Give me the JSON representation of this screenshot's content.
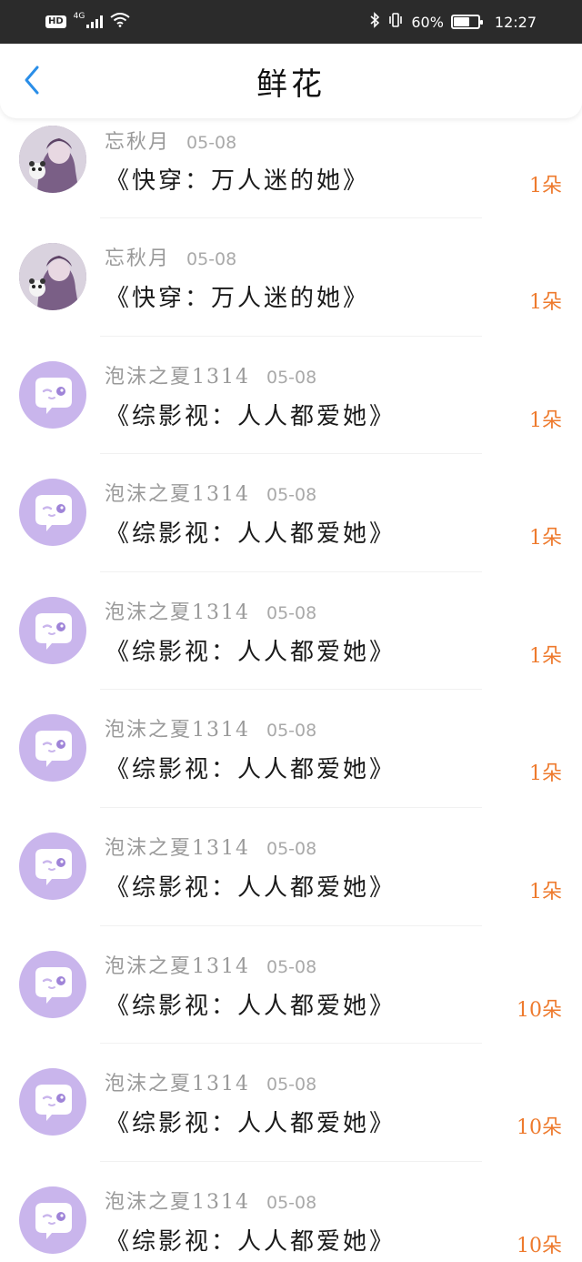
{
  "status_bar": {
    "hd": "HD",
    "network": "4G",
    "battery_percent": "60%",
    "battery_level": 0.6,
    "time": "12:27"
  },
  "header": {
    "back_icon": "chevron-left-icon",
    "title": "鲜花"
  },
  "colors": {
    "accent_blue": "#2a8ee8",
    "count_orange": "#ee7a2d",
    "avatar_purple": "#c9b5ec"
  },
  "items": [
    {
      "user": "忘秋月",
      "date": "05-08",
      "book": "《快穿：万人迷的她》",
      "count": "1朵",
      "avatar": "photo-avatar"
    },
    {
      "user": "忘秋月",
      "date": "05-08",
      "book": "《快穿：万人迷的她》",
      "count": "1朵",
      "avatar": "photo-avatar"
    },
    {
      "user": "泡沫之夏1314",
      "date": "05-08",
      "book": "《综影视：人人都爱她》",
      "count": "1朵",
      "avatar": "chat-bot-avatar"
    },
    {
      "user": "泡沫之夏1314",
      "date": "05-08",
      "book": "《综影视：人人都爱她》",
      "count": "1朵",
      "avatar": "chat-bot-avatar"
    },
    {
      "user": "泡沫之夏1314",
      "date": "05-08",
      "book": "《综影视：人人都爱她》",
      "count": "1朵",
      "avatar": "chat-bot-avatar"
    },
    {
      "user": "泡沫之夏1314",
      "date": "05-08",
      "book": "《综影视：人人都爱她》",
      "count": "1朵",
      "avatar": "chat-bot-avatar"
    },
    {
      "user": "泡沫之夏1314",
      "date": "05-08",
      "book": "《综影视：人人都爱她》",
      "count": "1朵",
      "avatar": "chat-bot-avatar"
    },
    {
      "user": "泡沫之夏1314",
      "date": "05-08",
      "book": "《综影视：人人都爱她》",
      "count": "10朵",
      "avatar": "chat-bot-avatar"
    },
    {
      "user": "泡沫之夏1314",
      "date": "05-08",
      "book": "《综影视：人人都爱她》",
      "count": "10朵",
      "avatar": "chat-bot-avatar"
    },
    {
      "user": "泡沫之夏1314",
      "date": "05-08",
      "book": "《综影视：人人都爱她》",
      "count": "10朵",
      "avatar": "chat-bot-avatar"
    }
  ]
}
